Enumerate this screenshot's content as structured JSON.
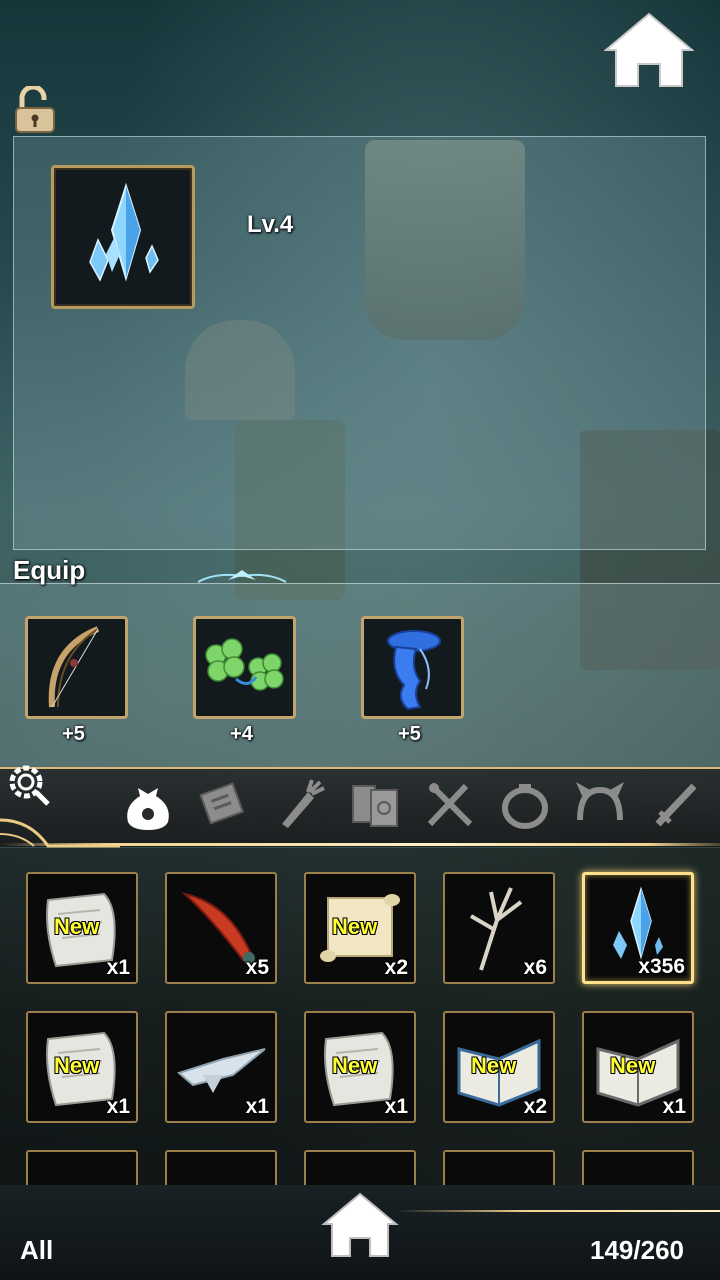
{
  "selected_item": {
    "level": "Lv.4",
    "icon": "blue-crystal-icon"
  },
  "equip": {
    "title": "Equip",
    "slots": [
      {
        "icon": "bow-icon",
        "bonus": "+5"
      },
      {
        "icon": "clover-icon",
        "bonus": "+4"
      },
      {
        "icon": "blue-scarf-icon",
        "bonus": "+5"
      }
    ]
  },
  "tabs": [
    {
      "name": "all-bag",
      "icon": "bag-icon",
      "active": true
    },
    {
      "name": "documents",
      "icon": "letter-icon",
      "active": false
    },
    {
      "name": "ingredients",
      "icon": "carrot-icon",
      "active": false
    },
    {
      "name": "books",
      "icon": "book-icon",
      "active": false
    },
    {
      "name": "tools",
      "icon": "utensils-icon",
      "active": false
    },
    {
      "name": "rings",
      "icon": "ring-icon",
      "active": false
    },
    {
      "name": "headgear",
      "icon": "headband-icon",
      "active": false
    },
    {
      "name": "weapons",
      "icon": "sword-icon",
      "active": false
    }
  ],
  "inventory": [
    {
      "icon": "scroll-icon",
      "new": "New",
      "qty": "x1"
    },
    {
      "icon": "red-feather-icon",
      "new": "",
      "qty": "x5"
    },
    {
      "icon": "parchment-icon",
      "new": "New",
      "qty": "x2"
    },
    {
      "icon": "branch-icon",
      "new": "",
      "qty": "x6"
    },
    {
      "icon": "blue-crystal-icon",
      "new": "",
      "qty": "x356",
      "selected": true
    },
    {
      "icon": "scroll-icon",
      "new": "New",
      "qty": "x1"
    },
    {
      "icon": "silver-wing-icon",
      "new": "",
      "qty": "x1"
    },
    {
      "icon": "scroll-icon",
      "new": "New",
      "qty": "x1"
    },
    {
      "icon": "open-book-icon",
      "new": "New",
      "qty": "x2"
    },
    {
      "icon": "open-book-icon",
      "new": "New",
      "qty": "x1"
    }
  ],
  "footer": {
    "filter": "All",
    "count": "149/260"
  },
  "colors": {
    "frame_gold": "#b79a5e",
    "new_yellow": "#ffff33",
    "selected_glow": "#ffe08a"
  }
}
